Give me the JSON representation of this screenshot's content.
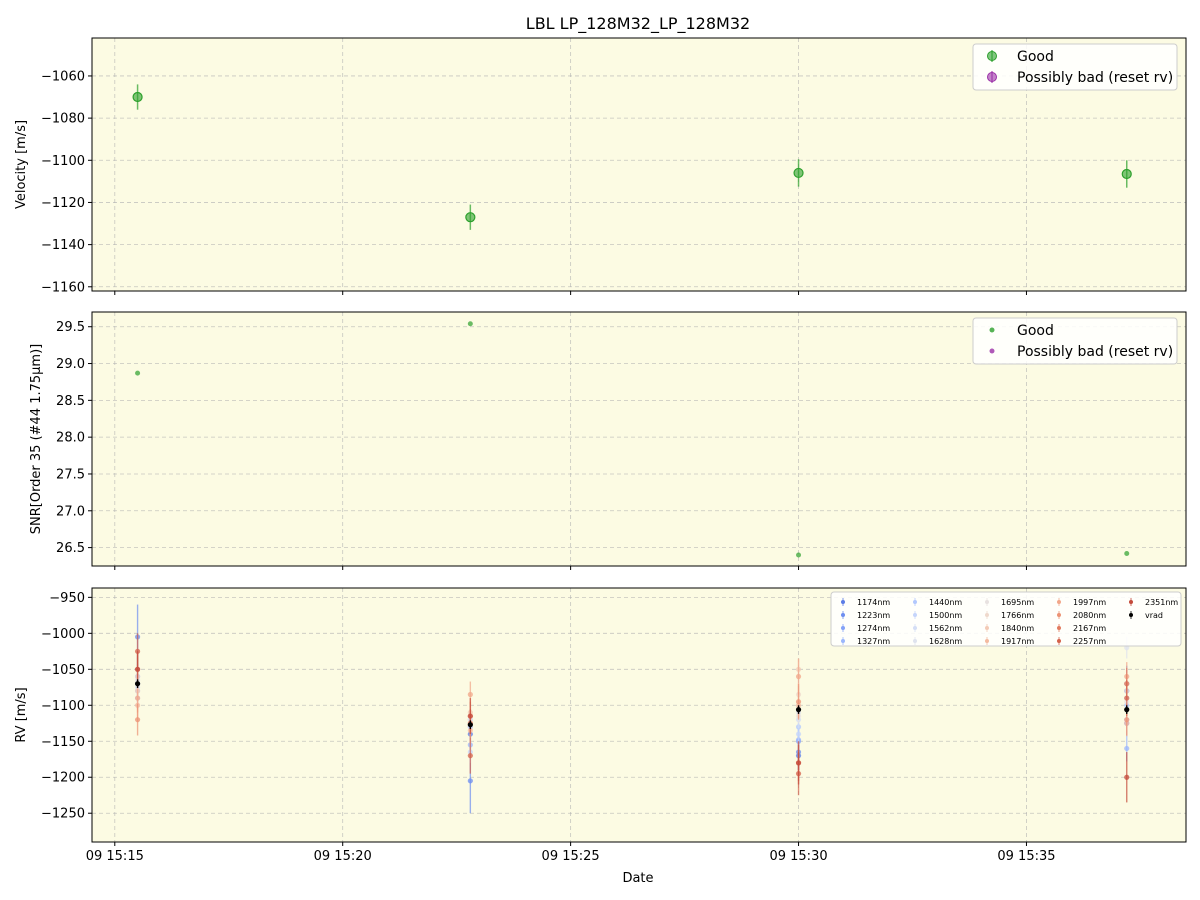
{
  "title": "LBL LP_128M32_LP_128M32",
  "xlabel": "Date",
  "x_tick_labels": [
    "09 15:15",
    "09 15:20",
    "09 15:25",
    "09 15:30",
    "09 15:35"
  ],
  "colors": {
    "good": "#2ca02c",
    "bad": "#9b30a8",
    "panel_bg": "#fcfbe3",
    "grid": "#b0b0b0",
    "vrad": "#000000"
  },
  "chart_data": [
    {
      "type": "scatter",
      "id": "velocity",
      "ylabel": "Velocity [m/s]",
      "ylim": [
        -1162,
        -1042
      ],
      "yticks": [
        -1060,
        -1080,
        -1100,
        -1120,
        -1140,
        -1160
      ],
      "xlim_minutes": [
        -0.5,
        23.5
      ],
      "xticks_minutes": [
        0,
        5,
        10,
        15,
        20
      ],
      "grid": true,
      "legend_position": "top-right",
      "legend": [
        "Good",
        "Possibly bad (reset rv)"
      ],
      "series": [
        {
          "name": "Good",
          "x": [
            "09 15:15:30",
            "09 15:22:48",
            "09 15:30:00",
            "09 15:37:12"
          ],
          "y": [
            -1070,
            -1127,
            -1106,
            -1106.5
          ],
          "yerr": [
            6,
            6,
            6.5,
            6.5
          ]
        },
        {
          "name": "Possibly bad (reset rv)",
          "x": [],
          "y": [],
          "yerr": []
        }
      ]
    },
    {
      "type": "scatter",
      "id": "snr",
      "ylabel": "SNR[Order 35 (#44 1.75μm)]",
      "ylim": [
        26.25,
        29.7
      ],
      "yticks": [
        29.5,
        29.0,
        28.5,
        28.0,
        27.5,
        27.0,
        26.5
      ],
      "ytick_labels": [
        "29.5",
        "29.0",
        "28.5",
        "28.0",
        "27.5",
        "27.0",
        "26.5"
      ],
      "grid": true,
      "legend_position": "top-right",
      "legend": [
        "Good",
        "Possibly bad (reset rv)"
      ],
      "series": [
        {
          "name": "Good",
          "x": [
            "09 15:15:30",
            "09 15:22:48",
            "09 15:30:00",
            "09 15:37:12"
          ],
          "y": [
            28.87,
            29.54,
            26.4,
            26.42
          ]
        },
        {
          "name": "Possibly bad (reset rv)",
          "x": [],
          "y": []
        }
      ]
    },
    {
      "type": "scatter",
      "id": "rv",
      "ylabel": "RV [m/s]",
      "ylim": [
        -1290,
        -937
      ],
      "yticks": [
        -950,
        -1000,
        -1050,
        -1100,
        -1150,
        -1200,
        -1250
      ],
      "grid": true,
      "legend_position": "top-right",
      "legend_columns": 5,
      "legend": [
        "1174nm",
        "1223nm",
        "1274nm",
        "1327nm",
        "1440nm",
        "1500nm",
        "1562nm",
        "1628nm",
        "1695nm",
        "1766nm",
        "1840nm",
        "1917nm",
        "1997nm",
        "2080nm",
        "2167nm",
        "2257nm",
        "2351nm",
        "vrad"
      ],
      "x": [
        "09 15:15:30",
        "09 15:22:48",
        "09 15:30:00",
        "09 15:37:12"
      ],
      "series": [
        {
          "name": "1174nm",
          "color": "#5b7ce6",
          "y": [
            -1070,
            -1140,
            -1170,
            -1080
          ],
          "yerr": [
            20,
            25,
            20,
            20
          ]
        },
        {
          "name": "1223nm",
          "color": "#6e8ef0",
          "y": [
            -1005,
            -1205,
            -1165,
            -1070
          ],
          "yerr": [
            45,
            45,
            25,
            25
          ]
        },
        {
          "name": "1274nm",
          "color": "#84a2f8",
          "y": [
            -1060,
            -1130,
            -1150,
            -1125
          ],
          "yerr": [
            18,
            18,
            18,
            18
          ]
        },
        {
          "name": "1327nm",
          "color": "#9bb6fc",
          "y": [
            -1050,
            -1155,
            -1148,
            -1160
          ],
          "yerr": [
            18,
            18,
            18,
            18
          ]
        },
        {
          "name": "1440nm",
          "color": "#b2c8fd",
          "y": [
            -1080,
            -1120,
            -1130,
            -1100
          ],
          "yerr": [
            15,
            15,
            15,
            15
          ]
        },
        {
          "name": "1500nm",
          "color": "#c5d5fb",
          "y": [
            -1090,
            -1165,
            -1140,
            -1120
          ],
          "yerr": [
            15,
            15,
            15,
            15
          ]
        },
        {
          "name": "1562nm",
          "color": "#d4def6",
          "y": [
            -1075,
            -1130,
            -1120,
            -1090
          ],
          "yerr": [
            12,
            12,
            12,
            12
          ]
        },
        {
          "name": "1628nm",
          "color": "#dfe3ee",
          "y": [
            -1065,
            -1115,
            -1110,
            -1020
          ],
          "yerr": [
            12,
            12,
            12,
            15
          ]
        },
        {
          "name": "1695nm",
          "color": "#e8e2e1",
          "y": [
            -1070,
            -1120,
            -1115,
            -1095
          ],
          "yerr": [
            10,
            10,
            10,
            10
          ]
        },
        {
          "name": "1766nm",
          "color": "#efd9cc",
          "y": [
            -1060,
            -1125,
            -1085,
            -1080
          ],
          "yerr": [
            12,
            12,
            12,
            12
          ]
        },
        {
          "name": "1840nm",
          "color": "#f3cbb6",
          "y": [
            -1080,
            -1110,
            -1050,
            -1070
          ],
          "yerr": [
            15,
            15,
            15,
            15
          ]
        },
        {
          "name": "1917nm",
          "color": "#f4baa0",
          "y": [
            -1100,
            -1135,
            -1100,
            -1125
          ],
          "yerr": [
            18,
            18,
            18,
            18
          ]
        },
        {
          "name": "1997nm",
          "color": "#f2a78a",
          "y": [
            -1090,
            -1085,
            -1060,
            -1060
          ],
          "yerr": [
            20,
            18,
            25,
            20
          ]
        },
        {
          "name": "2080nm",
          "color": "#ec9274",
          "y": [
            -1120,
            -1115,
            -1095,
            -1120
          ],
          "yerr": [
            22,
            20,
            25,
            22
          ]
        },
        {
          "name": "2167nm",
          "color": "#e27b5f",
          "y": [
            -1050,
            -1125,
            -1180,
            -1070
          ],
          "yerr": [
            22,
            20,
            25,
            22
          ]
        },
        {
          "name": "2257nm",
          "color": "#d4614b",
          "y": [
            -1025,
            -1170,
            -1195,
            -1090
          ],
          "yerr": [
            25,
            25,
            30,
            25
          ]
        },
        {
          "name": "2351nm",
          "color": "#c44a3a",
          "y": [
            -1050,
            -1115,
            -1180,
            -1200
          ],
          "yerr": [
            25,
            25,
            30,
            35
          ]
        },
        {
          "name": "vrad",
          "color": "#000000",
          "y": [
            -1070,
            -1127,
            -1106,
            -1106
          ],
          "yerr": [
            6,
            6,
            6,
            6
          ]
        }
      ]
    }
  ]
}
